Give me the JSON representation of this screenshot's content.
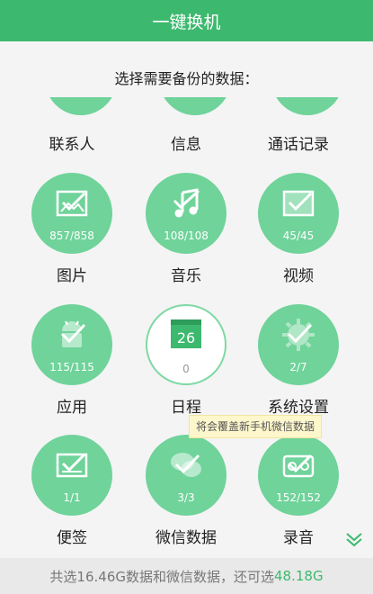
{
  "header": {
    "title": "一键换机"
  },
  "subtitle": "选择需要备份的数据：",
  "partial_row": [
    "联系人",
    "信息",
    "通话记录"
  ],
  "items": [
    {
      "label": "图片",
      "count": "857/858",
      "icon": "image-check-icon"
    },
    {
      "label": "音乐",
      "count": "108/108",
      "icon": "music-check-icon"
    },
    {
      "label": "视频",
      "count": "45/45",
      "icon": "video-check-icon"
    },
    {
      "label": "应用",
      "count": "115/115",
      "icon": "android-check-icon"
    },
    {
      "label": "日程",
      "count": "0",
      "icon": "calendar-icon",
      "calendar_day": "26"
    },
    {
      "label": "系统设置",
      "count": "2/7",
      "icon": "settings-check-icon"
    },
    {
      "label": "便签",
      "count": "1/1",
      "icon": "note-check-icon"
    },
    {
      "label": "微信数据",
      "count": "3/3",
      "icon": "wechat-check-icon"
    },
    {
      "label": "录音",
      "count": "152/152",
      "icon": "recorder-check-icon"
    }
  ],
  "tooltip": "将会覆盖新手机微信数据",
  "footer": {
    "prefix": "共选16.46G数据和微信数据，还可选",
    "available": "48.18G"
  },
  "colors": {
    "accent": "#3cb96e",
    "circle": "#6fd39a"
  }
}
